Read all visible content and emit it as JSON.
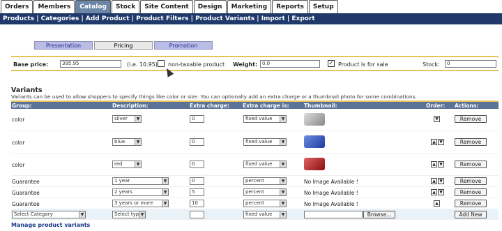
{
  "topnav": [
    "Orders",
    "Members",
    "Catalog",
    "Stock",
    "Site Content",
    "Design",
    "Marketing",
    "Reports",
    "Setup"
  ],
  "topnav_active": "Catalog",
  "subnav": [
    "Products",
    "Categories",
    "Add Product",
    "Product Filters",
    "Product Variants",
    "Import",
    "Export"
  ],
  "product_tabs": [
    "Presentation",
    "Pricing",
    "Promotion"
  ],
  "product_tabs_active": "Pricing",
  "pricing": {
    "base_price_label": "Base price:",
    "base_price_value": "395.95",
    "base_price_hint": "(i.e. 10.95)",
    "non_taxable_label": "non-taxable product",
    "non_taxable_checked": false,
    "weight_label": "Weight:",
    "weight_value": "0.0",
    "for_sale_label": "Product is for sale",
    "for_sale_checked": true,
    "stock_label": "Stock:",
    "stock_value": "0"
  },
  "variants": {
    "title": "Variants",
    "description": "Variants can be used to allow shoppers to specify things like color or size. You can optionally add an extra charge or a thumbnail photo for some combinations.",
    "columns": [
      "Group:",
      "Description:",
      "Extra charge:",
      "Extra charge is:",
      "Thumbnail:",
      "Order:",
      "Actions:"
    ],
    "rows": [
      {
        "group": "color",
        "description": "silver",
        "extra": "0",
        "extra_is": "fixed value",
        "thumbnail": "camera-silver",
        "order": [
          "down"
        ],
        "action": "Remove"
      },
      {
        "group": "color",
        "description": "blue",
        "extra": "0",
        "extra_is": "fixed value",
        "thumbnail": "camera-blue",
        "order": [
          "up",
          "down"
        ],
        "action": "Remove"
      },
      {
        "group": "color",
        "description": "red",
        "extra": "0",
        "extra_is": "fixed value",
        "thumbnail": "camera-red",
        "order": [
          "up",
          "down"
        ],
        "action": "Remove"
      },
      {
        "group": "Guarantee",
        "description": "1 year",
        "extra": "0",
        "extra_is": "percent",
        "thumbnail_text": "No Image Available !",
        "order": [
          "up",
          "down"
        ],
        "action": "Remove"
      },
      {
        "group": "Guarantee",
        "description": "2 years",
        "extra": "5",
        "extra_is": "percent",
        "thumbnail_text": "No Image Available !",
        "order": [
          "up",
          "down"
        ],
        "action": "Remove"
      },
      {
        "group": "Guarantee",
        "description": "3 years or more",
        "extra": "10",
        "extra_is": "percent",
        "thumbnail_text": "No Image Available !",
        "order": [
          "up"
        ],
        "action": "Remove"
      }
    ],
    "add_row": {
      "group": "Select Category",
      "description": "Select type",
      "extra": "",
      "extra_is": "fixed value",
      "browse_label": "Browse...",
      "action": "Add New"
    }
  },
  "manage_link": "Manage product variants",
  "colors": {
    "subnav_bg": "#1f3a6a",
    "header_bg": "#5b7396",
    "accent_border": "#e8c35a",
    "active_tab": "#6b87a8"
  }
}
